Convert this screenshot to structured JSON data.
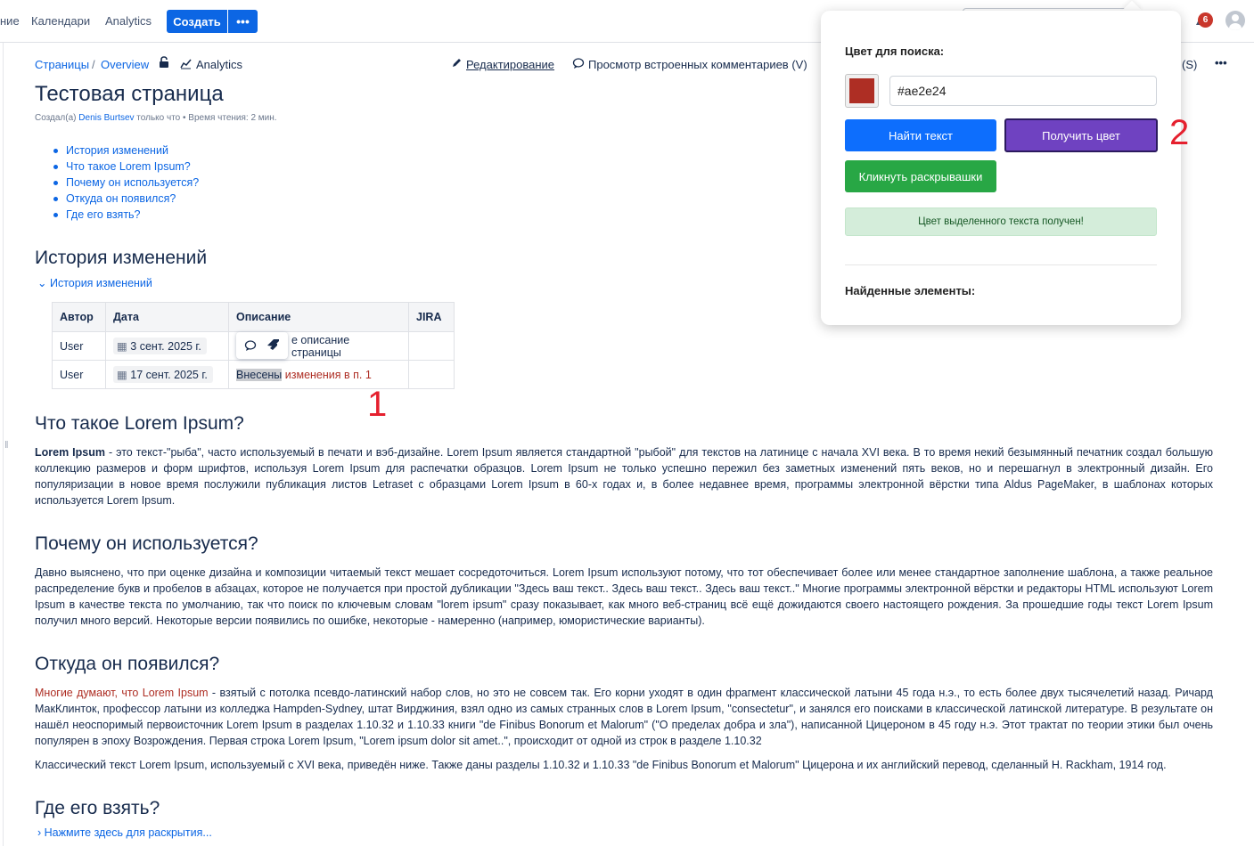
{
  "topnav": {
    "items": [
      "ние",
      "Календари",
      "Analytics"
    ],
    "create_label": "Создать",
    "more_label": "•••",
    "notification_count": "6"
  },
  "breadcrumb": {
    "pages": "Страницы",
    "sep": "/",
    "overview": "Overview",
    "analytics": "Analytics"
  },
  "page_actions": {
    "edit": "Редактирование",
    "comments": "Просмотр встроенных комментариев (V)",
    "more_hint": "(S)",
    "menu": "•••"
  },
  "page": {
    "title": "Тестовая страница",
    "meta_prefix": "Создал(а) ",
    "meta_author": "Denis Burtsev",
    "meta_suffix": " только что • Время чтения: 2 мин."
  },
  "toc": [
    "История изменений",
    "Что такое Lorem Ipsum?",
    "Почему он используется?",
    "Откуда он появился?",
    "Где его взять?"
  ],
  "history": {
    "heading": "История изменений",
    "expand_label": "История изменений",
    "columns": [
      "Автор",
      "Дата",
      "Описание",
      "JIRA"
    ],
    "rows": [
      {
        "author": "User",
        "date": "3 сент. 2025 г.",
        "desc": "е описание страницы",
        "jira": ""
      },
      {
        "author": "User",
        "date": "17 сент. 2025 г.",
        "desc_plain": "Внесены",
        "desc_red": " изменения в п. 1",
        "jira": ""
      }
    ]
  },
  "sections": {
    "lorem": {
      "heading": "Что такое Lorem Ipsum?",
      "bold": "Lorem Ipsum",
      "text": " - это текст-\"рыба\", часто используемый в печати и вэб-дизайне. Lorem Ipsum является стандартной \"рыбой\" для текстов на латинице с начала XVI века. В то время некий безымянный печатник создал большую коллекцию размеров и форм шрифтов, используя Lorem Ipsum для распечатки образцов. Lorem Ipsum не только успешно пережил без заметных изменений пять веков, но и перешагнул в электронный дизайн. Его популяризации в новое время послужили публикация листов Letraset с образцами Lorem Ipsum в 60-х годах и, в более недавнее время, программы электронной вёрстки типа Aldus PageMaker, в шаблонах которых используется Lorem Ipsum."
    },
    "why": {
      "heading": "Почему он используется?",
      "text": "Давно выяснено, что при оценке дизайна и композиции читаемый текст мешает сосредоточиться. Lorem Ipsum используют потому, что тот обеспечивает более или менее стандартное заполнение шаблона, а также реальное распределение букв и пробелов в абзацах, которое не получается при простой дубликации \"Здесь ваш текст.. Здесь ваш текст.. Здесь ваш текст..\" Многие программы электронной вёрстки и редакторы HTML используют Lorem Ipsum в качестве текста по умолчанию, так что поиск по ключевым словам \"lorem ipsum\" сразу показывает, как много веб-страниц всё ещё дожидаются своего настоящего рождения. За прошедшие годы текст Lorem Ipsum получил много версий. Некоторые версии появились по ошибке, некоторые - намеренно (например, юмористические варианты)."
    },
    "origin": {
      "heading": "Откуда он появился?",
      "red": "Многие думают, что Lorem Ipsum",
      "text": " - взятый с потолка псевдо-латинский набор слов, но это не совсем так. Его корни уходят в один фрагмент классической латыни 45 года н.э., то есть более двух тысячелетий назад. Ричард МакКлинток, профессор латыни из колледжа Hampden-Sydney, штат Вирджиния, взял одно из самых странных слов в Lorem Ipsum, \"consectetur\", и занялся его поисками в классической латинской литературе. В результате он нашёл неоспоримый первоисточник Lorem Ipsum в разделах 1.10.32 и 1.10.33 книги \"de Finibus Bonorum et Malorum\" (\"О пределах добра и зла\"), написанной Цицероном в 45 году н.э. Этот трактат по теории этики был очень популярен в эпоху Возрождения. Первая строка Lorem Ipsum, \"Lorem ipsum dolor sit amet..\", происходит от одной из строк в разделе 1.10.32",
      "text2": "Классический текст Lorem Ipsum, используемый с XVI века, приведён ниже. Также даны разделы 1.10.32 и 1.10.33 \"de Finibus Bonorum et Malorum\" Цицерона и их английский перевод, сделанный H. Rackham, 1914 год."
    },
    "where": {
      "heading": "Где его взять?",
      "expand_label": "Нажмите здесь для раскрытия..."
    }
  },
  "markers": {
    "one": "1",
    "two": "2"
  },
  "popup": {
    "label": "Цвет для поиска:",
    "color_value": "#ae2e24",
    "find_label": "Найти текст",
    "get_color_label": "Получить цвет",
    "expand_label": "Кликнуть раскрывашки",
    "status": "Цвет выделенного текста получен!",
    "found_label": "Найденные элементы:"
  },
  "colors": {
    "accent": "#0c66e4",
    "found_color": "#ae2e24",
    "btn_find": "#0d6efd",
    "btn_get": "#6f42c1",
    "btn_expand": "#28a745",
    "marker": "#e5202e"
  }
}
